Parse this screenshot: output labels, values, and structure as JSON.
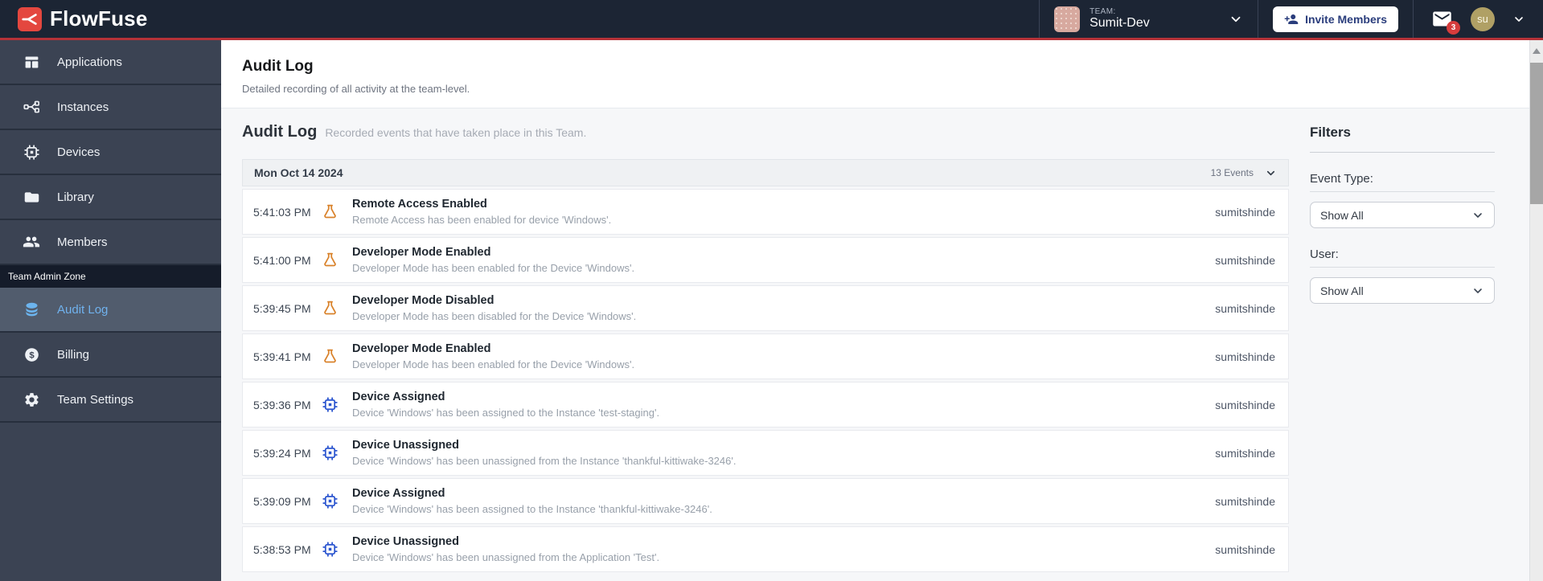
{
  "header": {
    "brand": "FlowFuse",
    "team_label": "TEAM:",
    "team_name": "Sumit-Dev",
    "invite_button": "Invite Members",
    "notification_count": "3",
    "avatar_initials": "su"
  },
  "sidebar": {
    "items": [
      {
        "label": "Applications",
        "icon": "applications-icon"
      },
      {
        "label": "Instances",
        "icon": "instances-icon"
      },
      {
        "label": "Devices",
        "icon": "devices-icon"
      },
      {
        "label": "Library",
        "icon": "library-icon"
      },
      {
        "label": "Members",
        "icon": "members-icon"
      }
    ],
    "admin_zone_label": "Team Admin Zone",
    "admin_items": [
      {
        "label": "Audit Log",
        "icon": "audit-log-icon",
        "selected": true
      },
      {
        "label": "Billing",
        "icon": "billing-icon",
        "selected": false
      },
      {
        "label": "Team Settings",
        "icon": "team-settings-icon",
        "selected": false
      }
    ]
  },
  "page": {
    "title": "Audit Log",
    "subtitle": "Detailed recording of all activity at the team-level."
  },
  "section": {
    "title": "Audit Log",
    "subtitle": "Recorded events that have taken place in this Team."
  },
  "audit": {
    "date_header": "Mon Oct 14 2024",
    "events_count": "13 Events",
    "rows": [
      {
        "time": "5:41:03 PM",
        "icon": "flask-icon",
        "title": "Remote Access Enabled",
        "description": "Remote Access has been enabled for device 'Windows'.",
        "user": "sumitshinde"
      },
      {
        "time": "5:41:00 PM",
        "icon": "flask-icon",
        "title": "Developer Mode Enabled",
        "description": "Developer Mode has been enabled for the Device 'Windows'.",
        "user": "sumitshinde"
      },
      {
        "time": "5:39:45 PM",
        "icon": "flask-icon",
        "title": "Developer Mode Disabled",
        "description": "Developer Mode has been disabled for the Device 'Windows'.",
        "user": "sumitshinde"
      },
      {
        "time": "5:39:41 PM",
        "icon": "flask-icon",
        "title": "Developer Mode Enabled",
        "description": "Developer Mode has been enabled for the Device 'Windows'.",
        "user": "sumitshinde"
      },
      {
        "time": "5:39:36 PM",
        "icon": "chip-icon",
        "title": "Device Assigned",
        "description": "Device 'Windows' has been assigned to the Instance 'test-staging'.",
        "user": "sumitshinde"
      },
      {
        "time": "5:39:24 PM",
        "icon": "chip-icon",
        "title": "Device Unassigned",
        "description": "Device 'Windows' has been unassigned from the Instance 'thankful-kittiwake-3246'.",
        "user": "sumitshinde"
      },
      {
        "time": "5:39:09 PM",
        "icon": "chip-icon",
        "title": "Device Assigned",
        "description": "Device 'Windows' has been assigned to the Instance 'thankful-kittiwake-3246'.",
        "user": "sumitshinde"
      },
      {
        "time": "5:38:53 PM",
        "icon": "chip-icon",
        "title": "Device Unassigned",
        "description": "Device 'Windows' has been unassigned from the Application 'Test'.",
        "user": "sumitshinde"
      }
    ]
  },
  "filters": {
    "title": "Filters",
    "event_type_label": "Event Type:",
    "event_type_value": "Show All",
    "user_label": "User:",
    "user_value": "Show All"
  },
  "colors": {
    "header_bg": "#1c2534",
    "brand_red": "#e4473f",
    "accent_line_red": "#b53238",
    "sidebar_bg": "#3b4353",
    "selected_item_bg": "#515c6d",
    "selected_item_text": "#70b2ee",
    "flask_orange": "#d9822b",
    "chip_blue": "#2b55cf",
    "badge_red": "#d63c3c",
    "avatar_olive": "#b0a065"
  }
}
